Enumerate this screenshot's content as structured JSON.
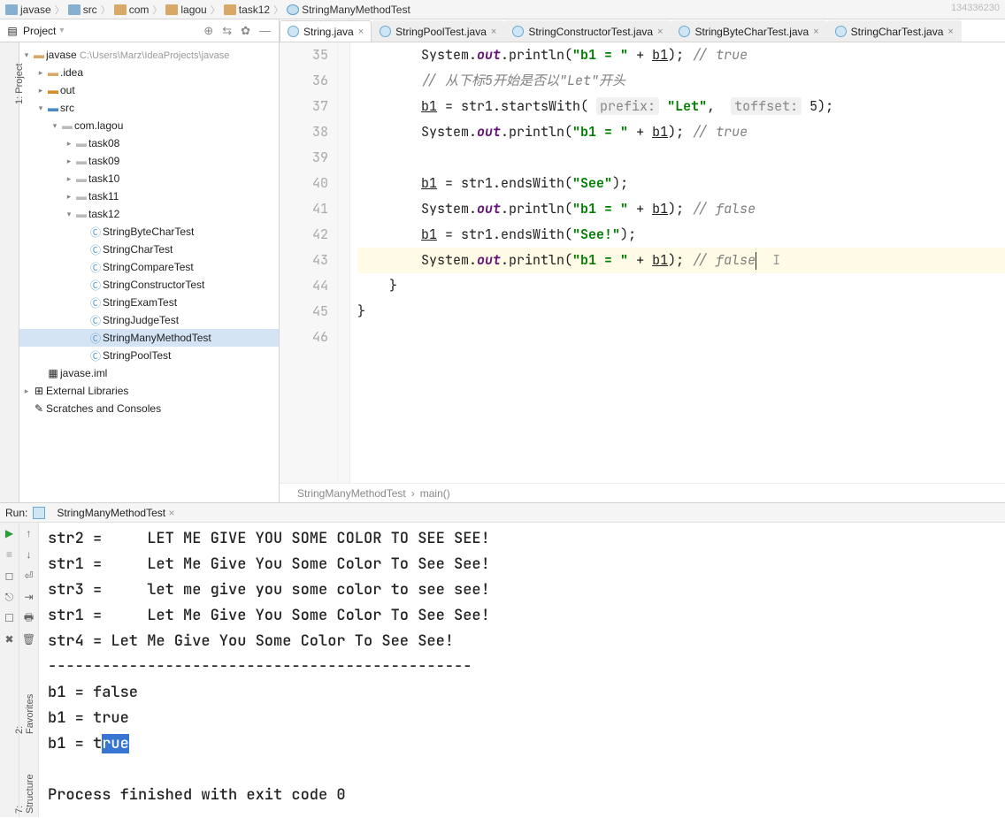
{
  "timestamp_frag": "134336230",
  "breadcrumb": [
    {
      "icon": "folder-blue",
      "label": "javase"
    },
    {
      "icon": "folder-blue",
      "label": "src"
    },
    {
      "icon": "folder",
      "label": "com"
    },
    {
      "icon": "folder",
      "label": "lagou"
    },
    {
      "icon": "folder",
      "label": "task12"
    },
    {
      "icon": "class",
      "label": "StringManyMethodTest"
    }
  ],
  "project_header": {
    "label": "Project"
  },
  "project_tree": [
    {
      "d": 0,
      "exp": "v",
      "icon": "dir",
      "label": "javase",
      "path": "C:\\Users\\Marz\\IdeaProjects\\javase"
    },
    {
      "d": 1,
      "exp": ">",
      "icon": "dir",
      "label": ".idea"
    },
    {
      "d": 1,
      "exp": ">",
      "icon": "dir",
      "label": "out",
      "cls": "orange"
    },
    {
      "d": 1,
      "exp": "v",
      "icon": "dir",
      "label": "src",
      "cls": "blue"
    },
    {
      "d": 2,
      "exp": "v",
      "icon": "pkg",
      "label": "com.lagou"
    },
    {
      "d": 3,
      "exp": ">",
      "icon": "pkg",
      "label": "task08"
    },
    {
      "d": 3,
      "exp": ">",
      "icon": "pkg",
      "label": "task09"
    },
    {
      "d": 3,
      "exp": ">",
      "icon": "pkg",
      "label": "task10"
    },
    {
      "d": 3,
      "exp": ">",
      "icon": "pkg",
      "label": "task11"
    },
    {
      "d": 3,
      "exp": "v",
      "icon": "pkg",
      "label": "task12"
    },
    {
      "d": 4,
      "exp": "",
      "icon": "cls",
      "label": "StringByteCharTest"
    },
    {
      "d": 4,
      "exp": "",
      "icon": "cls",
      "label": "StringCharTest"
    },
    {
      "d": 4,
      "exp": "",
      "icon": "cls",
      "label": "StringCompareTest"
    },
    {
      "d": 4,
      "exp": "",
      "icon": "cls",
      "label": "StringConstructorTest"
    },
    {
      "d": 4,
      "exp": "",
      "icon": "cls",
      "label": "StringExamTest"
    },
    {
      "d": 4,
      "exp": "",
      "icon": "cls",
      "label": "StringJudgeTest"
    },
    {
      "d": 4,
      "exp": "",
      "icon": "cls",
      "label": "StringManyMethodTest",
      "selected": true
    },
    {
      "d": 4,
      "exp": "",
      "icon": "cls",
      "label": "StringPoolTest"
    },
    {
      "d": 1,
      "exp": "",
      "icon": "file",
      "label": "javase.iml"
    },
    {
      "d": 0,
      "exp": ">",
      "icon": "lib",
      "label": "External Libraries"
    },
    {
      "d": 0,
      "exp": "",
      "icon": "scratch",
      "label": "Scratches and Consoles"
    }
  ],
  "tabs": [
    {
      "label": "String.java",
      "active": true
    },
    {
      "label": "StringPoolTest.java"
    },
    {
      "label": "StringConstructorTest.java"
    },
    {
      "label": "StringByteCharTest.java"
    },
    {
      "label": "StringCharTest.java"
    }
  ],
  "code_lines": [
    {
      "n": 35,
      "html": "        System.<span class='kw'>out</span>.println(<span class='str'>\"b1 = \"</span> + <span class='ul'>b1</span>); <span class='cm'>// true</span>"
    },
    {
      "n": 36,
      "html": "        <span class='cm'>// 从下标5开始是否以\"Let\"开头</span>"
    },
    {
      "n": 37,
      "html": "        <span class='ul'>b1</span> = str1.startsWith( <span class='hint'>prefix:</span> <span class='str'>\"Let\"</span>,  <span class='hint'>toffset:</span> 5);"
    },
    {
      "n": 38,
      "html": "        System.<span class='kw'>out</span>.println(<span class='str'>\"b1 = \"</span> + <span class='ul'>b1</span>); <span class='cm'>// true</span>"
    },
    {
      "n": 39,
      "html": ""
    },
    {
      "n": 40,
      "html": "        <span class='ul'>b1</span> = str1.endsWith(<span class='str'>\"See\"</span>);"
    },
    {
      "n": 41,
      "html": "        System.<span class='kw'>out</span>.println(<span class='str'>\"b1 = \"</span> + <span class='ul'>b1</span>); <span class='cm'>// false</span>"
    },
    {
      "n": 42,
      "html": "        <span class='ul'>b1</span> = str1.endsWith(<span class='str'>\"See!\"</span>);"
    },
    {
      "n": 43,
      "html": "        System.<span class='kw'>out</span>.println(<span class='str'>\"b1 = \"</span> + <span class='ul'>b1</span>); <span class='cm'>// false</span><span class='cursor-beam'></span>  <span style='color:#999'>I</span>",
      "hl": true
    },
    {
      "n": 44,
      "html": "    }"
    },
    {
      "n": 45,
      "html": "}"
    },
    {
      "n": 46,
      "html": ""
    }
  ],
  "nav_trace": {
    "class": "StringManyMethodTest",
    "method": "main()"
  },
  "run_header": {
    "label": "Run:",
    "tab": "StringManyMethodTest"
  },
  "side_labels": {
    "project": "1: Project",
    "favorites": "2: Favorites",
    "structure": "7: Structure"
  },
  "console_lines": [
    "str2 =     LET ME GIVE YOU SOME COLOR TO SEE SEE!",
    "str1 =     Let Me Give You Some Color To See See!",
    "str3 =     let me give you some color to see see!",
    "str1 =     Let Me Give You Some Color To See See!",
    "str4 = Let Me Give You Some Color To See See!",
    "-----------------------------------------------",
    "b1 = false",
    "b1 = true",
    {
      "pre": "b1 = t",
      "sel": "rue"
    },
    "",
    "Process finished with exit code 0"
  ]
}
